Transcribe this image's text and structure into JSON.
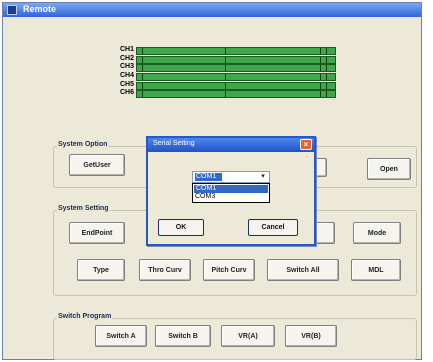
{
  "window": {
    "title": "Remote"
  },
  "channels": [
    "CH1",
    "CH2",
    "CH3",
    "CH4",
    "CH5",
    "CH6"
  ],
  "system_option": {
    "title": "System Option",
    "buttons": {
      "get_user": "GetUser",
      "open": "Open"
    }
  },
  "system_setting": {
    "title": "System Setting",
    "buttons": {
      "endpoint": "EndPoint",
      "mode": "Mode",
      "type": "Type",
      "thro_curv": "Thro Curv",
      "pitch_curv": "Pitch Curv",
      "switch_all": "Switch All",
      "mdl": "MDL"
    }
  },
  "switch_program": {
    "title": "Switch Program",
    "buttons": {
      "switch_a": "Switch A",
      "switch_b": "Switch B",
      "vr_a": "VR(A)",
      "vr_b": "VR(B)"
    }
  },
  "dialog": {
    "title": "Serial Setting",
    "port_value": "COM1",
    "port_options": [
      "COM1",
      "COM3"
    ],
    "ok_label": "OK",
    "cancel_label": "Cancel"
  },
  "colors": {
    "meter_green": "#3da84a",
    "titlebar_blue": "#2f64d8",
    "selection_blue": "#316ac5"
  }
}
